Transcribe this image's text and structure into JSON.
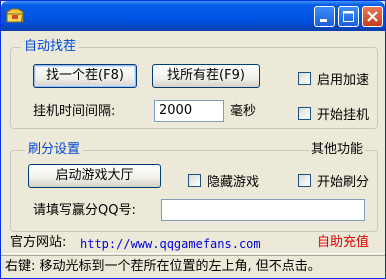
{
  "window": {
    "title": "",
    "app_icon": "folder-icon",
    "controls": {
      "minimize": "minimize-icon",
      "maximize": "maximize-icon",
      "close": "close-icon"
    }
  },
  "auto_find": {
    "legend": "自动找茬",
    "find_one_button": "找一个茬(F8)",
    "find_all_button": "找所有茬(F9)",
    "enable_speedup_label": "启用加速",
    "interval_label": "挂机时间间隔:",
    "interval_value": "2000",
    "interval_unit": "毫秒",
    "start_idle_label": "开始挂机"
  },
  "score_settings": {
    "legend": "刷分设置",
    "other_features_label": "其他功能",
    "launch_lobby_button": "启动游戏大厅",
    "hide_game_label": "隐藏游戏",
    "start_brush_label": "开始刷分",
    "qq_label": "请填写赢分QQ号:",
    "qq_value": ""
  },
  "footer": {
    "site_label": "官方网站:",
    "site_url": "http://www.qqgamefans.com",
    "recharge_link": "自助充值"
  },
  "status_bar": {
    "text": "右键: 移动光标到一个茬所在位置的左上角, 但不点击。"
  },
  "colors": {
    "legend": "#0046d5",
    "link": "#0000e0",
    "recharge": "#e00000",
    "titlebar": "#0055e5"
  }
}
